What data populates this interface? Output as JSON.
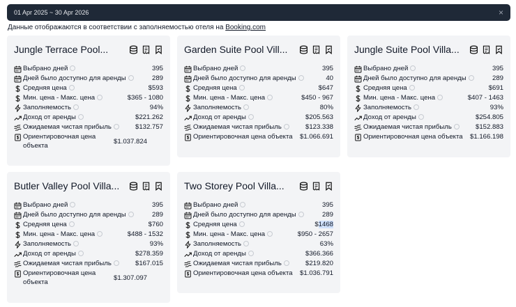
{
  "date_range": {
    "label": "01 Apr 2025 ~ 30 Apr 2026",
    "clear_symbol": "×"
  },
  "notice": {
    "text": "Данные отображаются в соответствии с заполняемостью отеля на ",
    "link": "Booking.com"
  },
  "labels": {
    "days_selected": "Выбрано дней",
    "days_available": "Дней было доступно для аренды",
    "avg_price": "Средняя цена",
    "min_max_price": "Мин. цена - Макс. цена",
    "occupancy": "Заполняемость",
    "rental_income": "Доход от аренды",
    "net_profit": "Ожидаемая чистая прибыль",
    "est_price": "Ориентировочная цена объекта"
  },
  "cards": [
    {
      "title": "Jungle Terrace Pool...",
      "days_selected": "395",
      "days_available": "289",
      "avg_price": "$593",
      "min_max_price": "$365 - 1080",
      "occupancy": "94%",
      "rental_income": "$221.262",
      "net_profit": "$132.757",
      "est_price": "$1.037.824"
    },
    {
      "title": "Garden Suite Pool Vill...",
      "days_selected": "395",
      "days_available": "40",
      "avg_price": "$647",
      "min_max_price": "$450 - 967",
      "occupancy": "80%",
      "rental_income": "$205.563",
      "net_profit": "$123.338",
      "est_price": "$1.066.691"
    },
    {
      "title": "Jungle Suite Pool Villa...",
      "days_selected": "395",
      "days_available": "289",
      "avg_price": "$691",
      "min_max_price": "$407 - 1463",
      "occupancy": "93%",
      "rental_income": "$254.805",
      "net_profit": "$152.883",
      "est_price": "$1.166.198"
    },
    {
      "title": "Butler Valley Pool Villa...",
      "days_selected": "395",
      "days_available": "289",
      "avg_price": "$760",
      "min_max_price": "$488 - 1532",
      "occupancy": "93%",
      "rental_income": "$278.359",
      "net_profit": "$167.015",
      "est_price": "$1.307.097"
    },
    {
      "title": "Two Storey Pool Villa...",
      "days_selected": "395",
      "days_available": "289",
      "avg_price_prefix": "$",
      "avg_price_value": "1468",
      "min_max_price": "$950 - 2657",
      "occupancy": "63%",
      "rental_income": "$366.366",
      "net_profit": "$219.820",
      "est_price": "$1.036.791"
    }
  ]
}
